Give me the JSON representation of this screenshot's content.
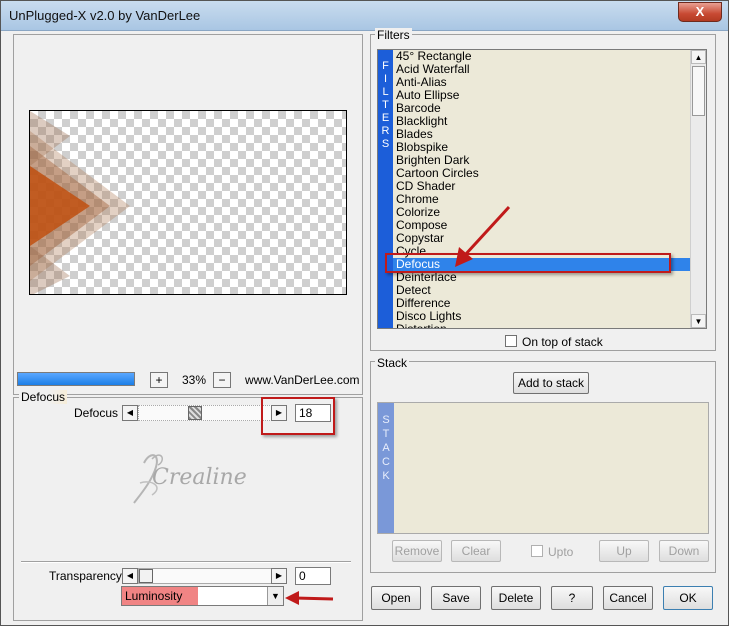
{
  "window": {
    "title": "UnPlugged-X v2.0 by VanDerLee",
    "close_label": "X"
  },
  "preview": {
    "zoom": "33%",
    "zoom_in": "+",
    "zoom_out": "−",
    "url": "www.VanDerLee.com"
  },
  "defocus": {
    "group_label": "Defocus",
    "param_label": "Defocus",
    "value": "18",
    "slider_fraction": 0.4
  },
  "transparency": {
    "label": "Transparency",
    "value": "0",
    "slider_fraction": 0.0
  },
  "blend": {
    "selected": "Luminosity"
  },
  "watermark": "Crealine",
  "filters": {
    "group_label": "Filters",
    "strip_letters": [
      "F",
      "I",
      "L",
      "T",
      "E",
      "R",
      "S"
    ],
    "items": [
      "45° Rectangle",
      "Acid Waterfall",
      "Anti-Alias",
      "Auto Ellipse",
      "Barcode",
      "Blacklight",
      "Blades",
      "Blobspike",
      "Brighten Dark",
      "Cartoon Circles",
      "CD Shader",
      "Chrome",
      "Colorize",
      "Compose",
      "Copystar",
      "Cycle",
      "Defocus",
      "Deinterlace",
      "Detect",
      "Difference",
      "Disco Lights",
      "Distortion"
    ],
    "selected": "Defocus",
    "on_top_label": "On top of stack"
  },
  "stack": {
    "group_label": "Stack",
    "add_label": "Add to stack",
    "strip_letters": [
      "S",
      "T",
      "A",
      "C",
      "K"
    ],
    "remove_label": "Remove",
    "clear_label": "Clear",
    "upto_label": "Upto",
    "up_label": "Up",
    "down_label": "Down"
  },
  "buttons": {
    "open": "Open",
    "save": "Save",
    "delete": "Delete",
    "help": "?",
    "cancel": "Cancel",
    "ok": "OK"
  },
  "colors": {
    "selection": "#2f83ea",
    "strip": "#1c5ed9",
    "annotation": "#c01a1a",
    "highlight": "#f08484"
  }
}
